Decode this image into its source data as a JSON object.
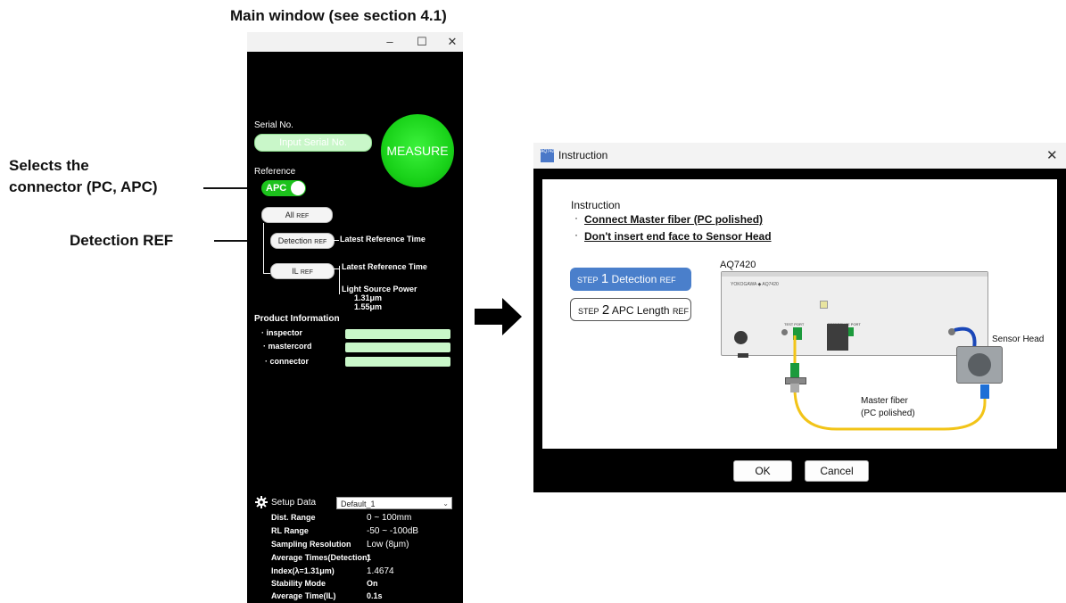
{
  "annotations": {
    "main_window": "Main window (see section 4.1)",
    "connector_line1": "Selects the",
    "connector_line2": "connector (PC, APC)",
    "detection_ref": "Detection REF"
  },
  "main_window": {
    "serial_label": "Serial No.",
    "serial_placeholder": "Input Serial No.",
    "measure_label": "MEASURE",
    "reference_label": "Reference",
    "toggle_value": "APC",
    "all_ref": "All",
    "detection_ref": "Detection",
    "il_ref": "IL",
    "ref_suffix": "REF",
    "latest_ref_time_1": "Latest Reference Time",
    "latest_ref_time_2": "Latest Reference Time",
    "light_source_power": "Light Source Power",
    "wavelength_1": "1.31μm",
    "wavelength_2": "1.55μm",
    "product_info_title": "Product Information",
    "product_fields": [
      "· inspector",
      "· mastercord",
      "· connector"
    ],
    "setup_data_label": "Setup Data",
    "setup_select_value": "Default_1",
    "setup_rows": [
      {
        "label": "Dist. Range",
        "value": "0 ~ 100mm"
      },
      {
        "label": "RL Range",
        "value": "-50 ~ -100dB"
      },
      {
        "label": "Sampling Resolution",
        "value": "Low (8μm)"
      },
      {
        "label": "Average Times(Detection)",
        "value": "1"
      },
      {
        "label": "Index(λ=1.31μm)",
        "value": "1.4674"
      },
      {
        "label": "Stability Mode",
        "value": "On"
      },
      {
        "label": "Average Time(IL)",
        "value": "0.1s"
      }
    ]
  },
  "dialog": {
    "app_icon_text": "AQ7420",
    "title": "Instruction",
    "heading": "Instruction",
    "bullet_1": "Connect Master fiber (PC polished)",
    "bullet_2": "Don't insert end face to Sensor Head",
    "step1_prefix": "STEP",
    "step1_number": "1",
    "step1_label": "Detection",
    "step2_prefix": "STEP",
    "step2_number": "2",
    "step2_label": "APC Length",
    "ref_suffix": "REF",
    "device_label": "AQ7420",
    "device_brand": "YOKOGAWA ◆ AQ7420",
    "test_port_label": "TEST PORT",
    "reference_port_label": "REFERENCE PORT",
    "sensor_head_label": "Sensor Head",
    "master_fiber_line1": "Master fiber",
    "master_fiber_line2": "(PC polished)",
    "ok_label": "OK",
    "cancel_label": "Cancel"
  },
  "colors": {
    "measure_green": "#1cd21c",
    "field_green": "#c9f7c9",
    "step_active": "#4a7fcb",
    "fiber_yellow": "#f2c418"
  }
}
